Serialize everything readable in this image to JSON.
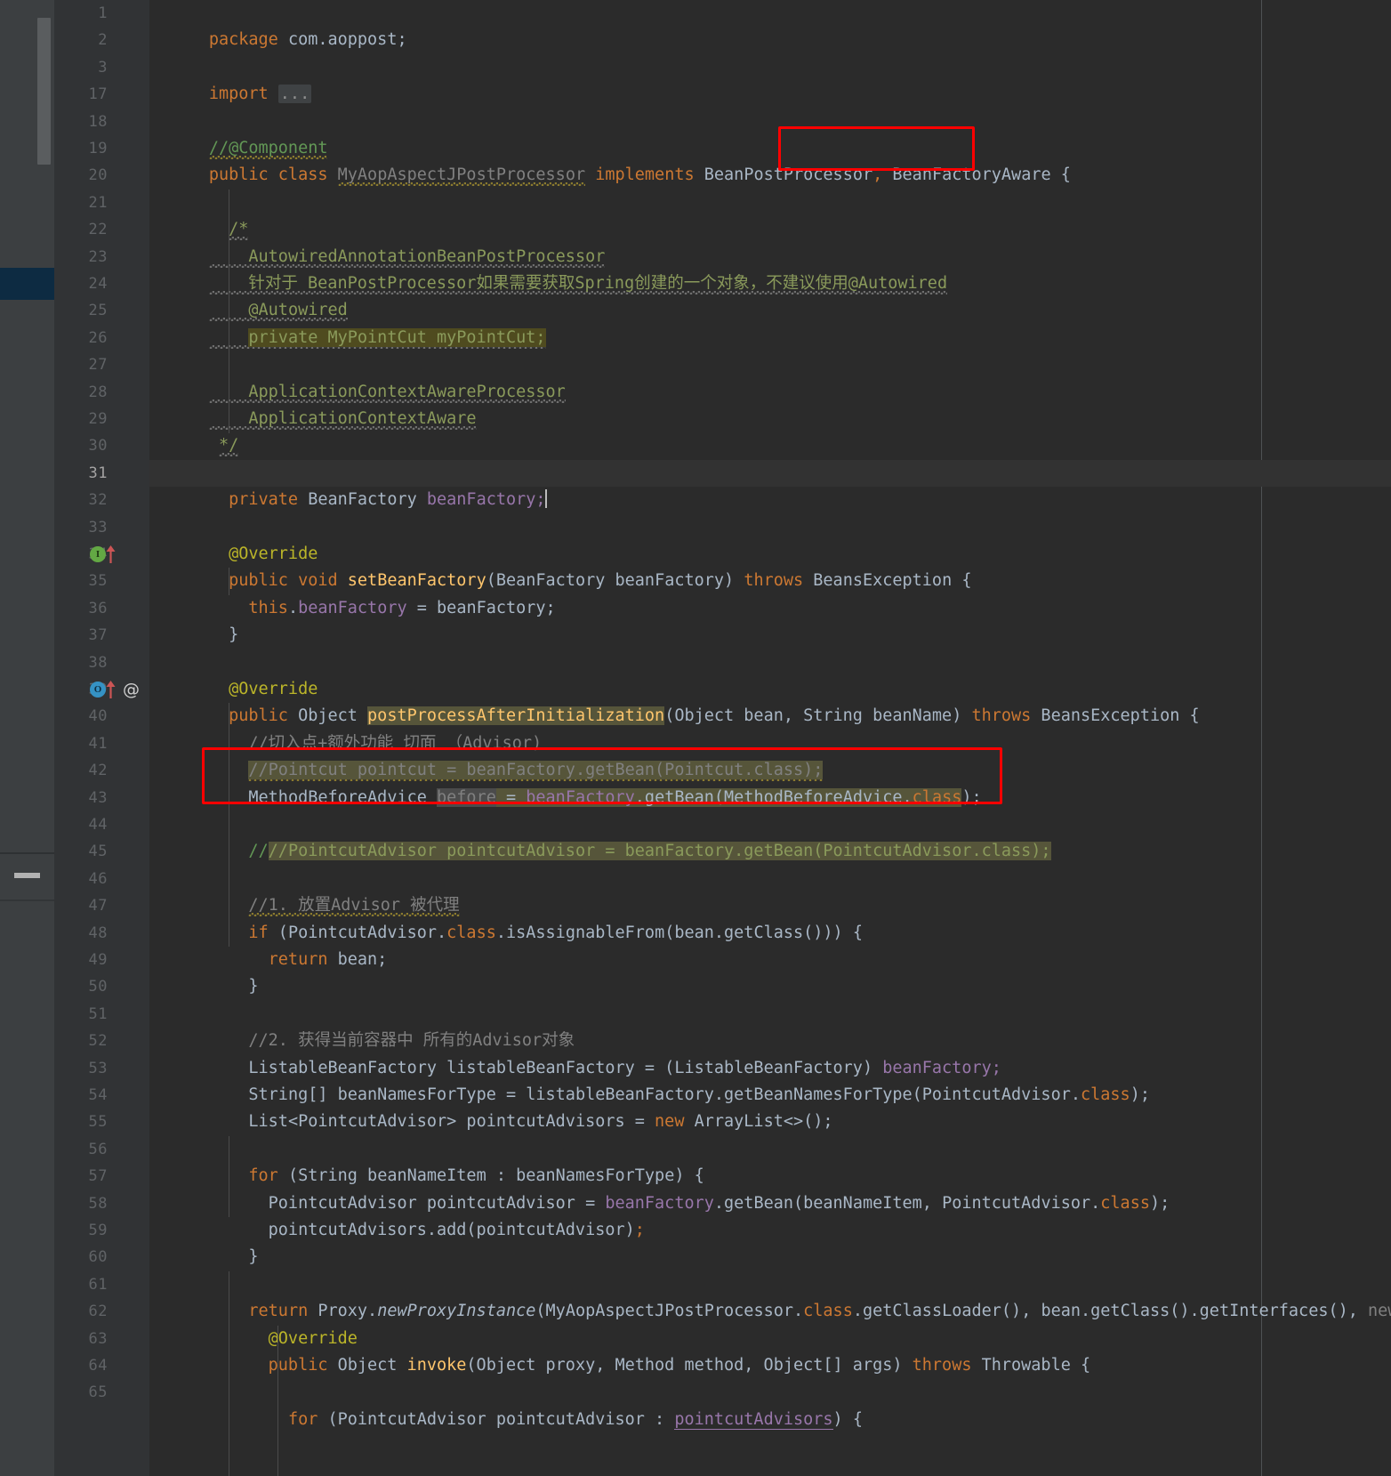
{
  "editor": {
    "language": "Java",
    "theme": "Darcula",
    "colors": {
      "background": "#2b2b2b",
      "gutter_background": "#313335",
      "current_line": "#323232",
      "keyword": "#cc7832",
      "field": "#9876aa",
      "method": "#ffc66d",
      "comment": "#808080",
      "doc_comment": "#8a9a5b",
      "annotation": "#bbb529",
      "identifier": "#a9b7c6",
      "number": "#6897bb",
      "annotation_box": "#ff0000",
      "marker_band": "#0d2b42",
      "impl_badge": "#63a844",
      "override_badge": "#3592c4",
      "gutter_arrow": "#cc5555"
    },
    "caret_after": "private BeanFactory beanFactory;",
    "current_line_number": 31,
    "margin_column_x": 1250
  },
  "gutter": {
    "line_numbers": [
      1,
      2,
      3,
      17,
      18,
      19,
      20,
      21,
      22,
      23,
      24,
      25,
      26,
      27,
      28,
      29,
      30,
      31,
      32,
      33,
      34,
      35,
      36,
      37,
      38,
      39,
      40,
      41,
      42,
      43,
      44,
      45,
      46,
      47,
      48,
      49,
      50,
      51,
      52,
      53,
      54,
      55,
      56,
      57,
      58,
      59,
      60,
      61,
      62,
      63,
      64,
      65
    ],
    "markers": [
      {
        "line": 34,
        "badge": "I",
        "badge_kind": "implementing-method",
        "arrow": "up",
        "extra": ""
      },
      {
        "line": 39,
        "badge": "O",
        "badge_kind": "overriding-method",
        "arrow": "up",
        "extra": "@"
      }
    ]
  },
  "code": {
    "lines": [
      {
        "n": 1,
        "text": "package com.aoppost;"
      },
      {
        "n": 2,
        "text": ""
      },
      {
        "n": 3,
        "text": "import ..."
      },
      {
        "n": 17,
        "text": ""
      },
      {
        "n": 18,
        "text": "//@Component"
      },
      {
        "n": 19,
        "text": "public class MyAopAspectJPostProcessor implements BeanPostProcessor, BeanFactoryAware {"
      },
      {
        "n": 20,
        "text": ""
      },
      {
        "n": 21,
        "text": "    /*"
      },
      {
        "n": 22,
        "text": "       AutowiredAnnotationBeanPostProcessor"
      },
      {
        "n": 23,
        "text": "       针对于 BeanPostProcessor如果需要获取Spring创建的一个对象，不建议使用@Autowired"
      },
      {
        "n": 24,
        "text": "       @Autowired"
      },
      {
        "n": 25,
        "text": "       private MyPointCut myPointCut;"
      },
      {
        "n": 26,
        "text": ""
      },
      {
        "n": 27,
        "text": "       ApplicationContextAwareProcessor"
      },
      {
        "n": 28,
        "text": "       ApplicationContextAware"
      },
      {
        "n": 29,
        "text": "     */"
      },
      {
        "n": 30,
        "text": ""
      },
      {
        "n": 31,
        "text": "    private BeanFactory beanFactory;"
      },
      {
        "n": 32,
        "text": ""
      },
      {
        "n": 33,
        "text": "    @Override"
      },
      {
        "n": 34,
        "text": "    public void setBeanFactory(BeanFactory beanFactory) throws BeansException {"
      },
      {
        "n": 35,
        "text": "        this.beanFactory = beanFactory;"
      },
      {
        "n": 36,
        "text": "    }"
      },
      {
        "n": 37,
        "text": ""
      },
      {
        "n": 38,
        "text": "    @Override"
      },
      {
        "n": 39,
        "text": "    public Object postProcessAfterInitialization(Object bean, String beanName) throws BeansException {"
      },
      {
        "n": 40,
        "text": "        //切入点+额外功能 切面 （Advisor)"
      },
      {
        "n": 41,
        "text": "        //Pointcut pointcut = beanFactory.getBean(Pointcut.class);"
      },
      {
        "n": 42,
        "text": "        MethodBeforeAdvice before = beanFactory.getBean(MethodBeforeAdvice.class);"
      },
      {
        "n": 43,
        "text": ""
      },
      {
        "n": 44,
        "text": "        //PointcutAdvisor pointcutAdvisor = beanFactory.getBean(PointcutAdvisor.class);"
      },
      {
        "n": 45,
        "text": ""
      },
      {
        "n": 46,
        "text": "        //1. 放置Advisor 被代理"
      },
      {
        "n": 47,
        "text": "        if (PointcutAdvisor.class.isAssignableFrom(bean.getClass())) {"
      },
      {
        "n": 48,
        "text": "            return bean;"
      },
      {
        "n": 49,
        "text": "        }"
      },
      {
        "n": 50,
        "text": ""
      },
      {
        "n": 51,
        "text": "        //2. 获得当前容器中 所有的Advisor对象"
      },
      {
        "n": 52,
        "text": "        ListableBeanFactory listableBeanFactory = (ListableBeanFactory) beanFactory;"
      },
      {
        "n": 53,
        "text": "        String[] beanNamesForType = listableBeanFactory.getBeanNamesForType(PointcutAdvisor.class);"
      },
      {
        "n": 54,
        "text": "        List<PointcutAdvisor> pointcutAdvisors = new ArrayList<>();"
      },
      {
        "n": 55,
        "text": ""
      },
      {
        "n": 56,
        "text": "        for (String beanNameItem : beanNamesForType) {"
      },
      {
        "n": 57,
        "text": "            PointcutAdvisor pointcutAdvisor = beanFactory.getBean(beanNameItem, PointcutAdvisor.class);"
      },
      {
        "n": 58,
        "text": "            pointcutAdvisors.add(pointcutAdvisor);"
      },
      {
        "n": 59,
        "text": "        }"
      },
      {
        "n": 60,
        "text": ""
      },
      {
        "n": 61,
        "text": "        return Proxy.newProxyInstance(MyAopAspectJPostProcessor.class.getClassLoader(), bean.getClass().getInterfaces(), new"
      },
      {
        "n": 62,
        "text": "            @Override"
      },
      {
        "n": 63,
        "text": "            public Object invoke(Object proxy, Method method, Object[] args) throws Throwable {"
      },
      {
        "n": 64,
        "text": ""
      },
      {
        "n": 65,
        "text": "                for (PointcutAdvisor pointcutAdvisor : pointcutAdvisors) {"
      }
    ]
  },
  "annotations": {
    "boxes": [
      {
        "id": "box-implements-beanfactoryaware",
        "label": ", BeanFactoryAware {",
        "line": 19
      },
      {
        "id": "box-get-methodbeforeadvice",
        "label": "MethodBeforeAdvice before = beanFactory.getBean(MethodBeforeAdvice.class);",
        "line": 42
      }
    ]
  },
  "tokens": {
    "l1_package": "package",
    "l1_name": "com.aoppost;",
    "l3_import": "import",
    "l3_fold": "...",
    "l18": "//@Component",
    "l19_public": "public",
    "l19_class": "class",
    "l19_name": "MyAopAspectJPostProcessor",
    "l19_implements": "implements",
    "l19_iface1": "BeanPostProcessor",
    "l19_comma": ",",
    "l19_iface2": " BeanFactoryAware {",
    "l21": "/*",
    "l22": "AutowiredAnnotationBeanPostProcessor",
    "l23": "针对于 BeanPostProcessor如果需要获取Spring创建的一个对象，不建议使用@Autowired",
    "l24": "@Autowired",
    "l25": "private MyPointCut myPointCut;",
    "l27": "ApplicationContextAwareProcessor",
    "l28": "ApplicationContextAware",
    "l29": "*/",
    "l31_private": "private",
    "l31_type": " BeanFactory ",
    "l31_name": "beanFactory;",
    "l33_override": "@Override",
    "l34_public": "public",
    "l34_void": "void",
    "l34_mth": "setBeanFactory",
    "l34_args": "(BeanFactory beanFactory) ",
    "l34_throws": "throws",
    "l34_tail": " BeansException {",
    "l35_this": "this",
    "l35_dot": ".",
    "l35_field": "beanFactory",
    "l35_tail": " = beanFactory;",
    "l36": "}",
    "l38_override": "@Override",
    "l39_public": "public",
    "l39_object": " Object ",
    "l39_mth": "postProcessAfterInitialization",
    "l39_args": "(Object bean, String beanName) ",
    "l39_throws": "throws",
    "l39_tail": " BeansException {",
    "l40": "//切入点+额外功能 切面 （Advisor)",
    "l41": "//Pointcut pointcut = beanFactory.getBean(Pointcut.class);",
    "l42_type": "MethodBeforeAdvice ",
    "l42_var": "before",
    "l42_eq": " = ",
    "l42_fac": "beanFactory",
    "l42_call": ".getBean(MethodBeforeAdvice.",
    "l42_class": "class",
    "l42_end": ");",
    "l44": "//PointcutAdvisor pointcutAdvisor = beanFactory.getBean(PointcutAdvisor.class);",
    "l46": "//1. 放置Advisor 被代理",
    "l47_if": "if",
    "l47_a": " (PointcutAdvisor.",
    "l47_class": "class",
    "l47_b": ".isAssignableFrom(bean.getClass())) {",
    "l48_return": "return",
    "l48_tail": " bean;",
    "l49": "}",
    "l51": "//2. 获得当前容器中 所有的Advisor对象",
    "l52_a": "ListableBeanFactory listableBeanFactory = (ListableBeanFactory) ",
    "l52_fld": "beanFactory;",
    "l53_a": "String[] beanNamesForType = listableBeanFactory.getBeanNamesForType(PointcutAdvisor.",
    "l53_class": "class",
    "l53_b": ");",
    "l54_a": "List<PointcutAdvisor> pointcutAdvisors = ",
    "l54_new": "new",
    "l54_b": " ArrayList<>();",
    "l56_for": "for",
    "l56_tail": " (String beanNameItem : beanNamesForType) {",
    "l57_a": "PointcutAdvisor pointcutAdvisor = ",
    "l57_fac": "beanFactory",
    "l57_b": ".getBean(beanNameItem, PointcutAdvisor.",
    "l57_class": "class",
    "l57_c": ");",
    "l58_a": "pointcutAdvisors.add(pointcutAdvisor)",
    "l58_semi": ";",
    "l59": "}",
    "l61_return": "return",
    "l61_proxy": " Proxy.",
    "l61_mth": "newProxyInstance",
    "l61_args": "(MyAopAspectJPostProcessor.",
    "l61_class": "class",
    "l61_b": ".getClassLoader(), bean.getClass().getInterfaces(),",
    "l61_new": " new",
    "l62": "@Override",
    "l63_public": "public",
    "l63_obj": " Object ",
    "l63_mth": "invoke",
    "l63_args": "(Object proxy, Method method, Object[] args) ",
    "l63_throws": "throws",
    "l63_tail": " Throwable {",
    "l65_for": "for",
    "l65_a": " (PointcutAdvisor pointcutAdvisor : ",
    "l65_ident": "pointcutAdvisors",
    "l65_b": ") {"
  }
}
